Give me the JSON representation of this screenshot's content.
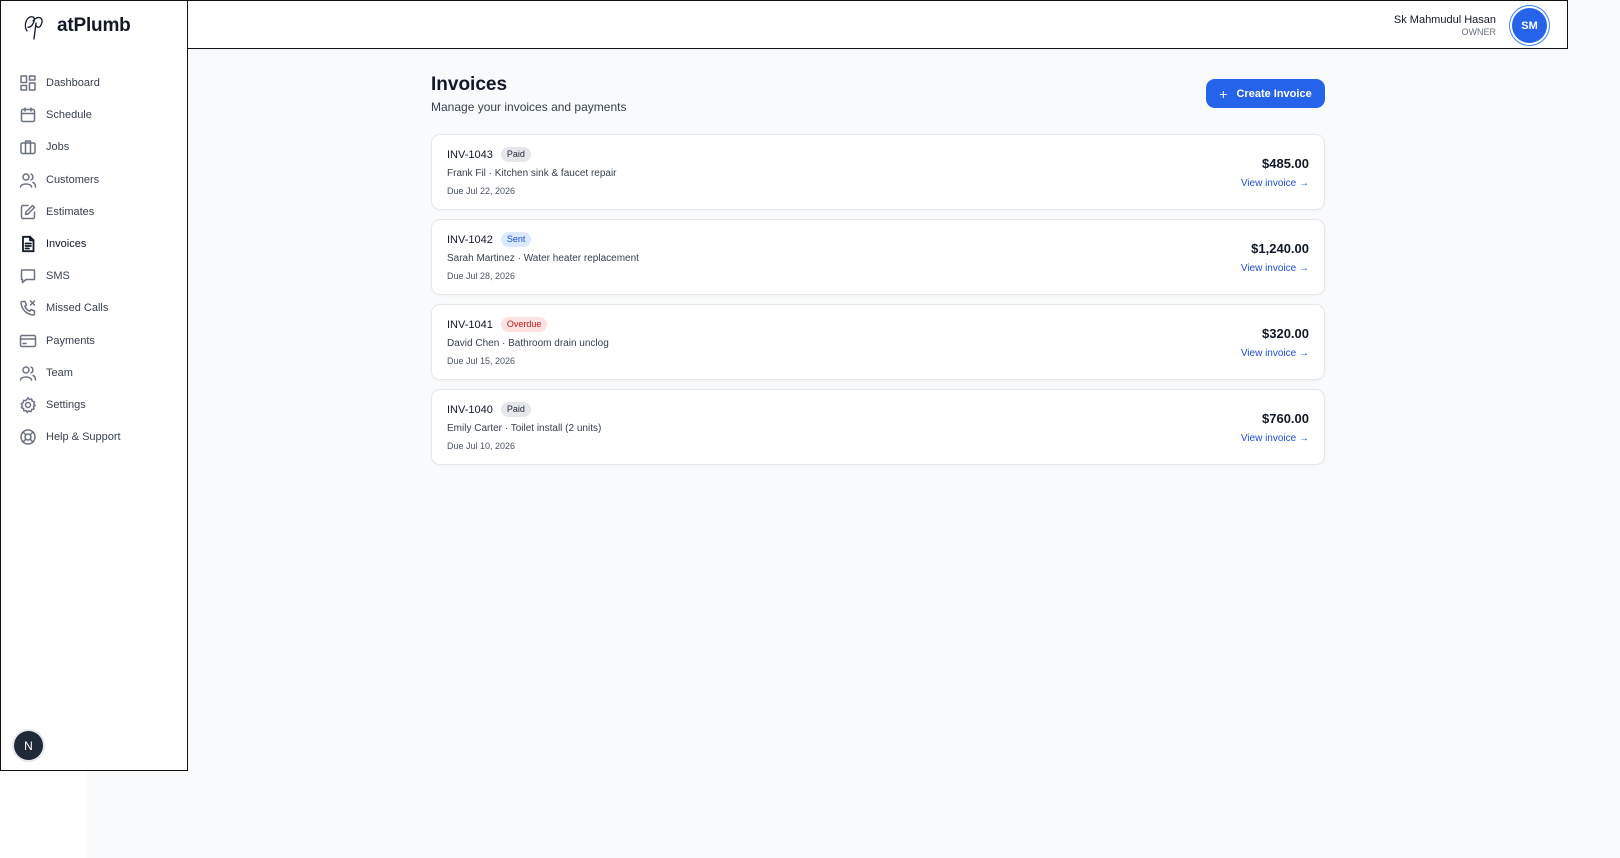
{
  "brand": {
    "name": "atPlumb"
  },
  "sidebar": {
    "items": [
      {
        "label": "Dashboard",
        "icon": "dashboard-icon",
        "active": false
      },
      {
        "label": "Schedule",
        "icon": "calendar-icon",
        "active": false
      },
      {
        "label": "Jobs",
        "icon": "briefcase-icon",
        "active": false
      },
      {
        "label": "Customers",
        "icon": "users-icon",
        "active": false
      },
      {
        "label": "Estimates",
        "icon": "edit-document-icon",
        "active": false
      },
      {
        "label": "Invoices",
        "icon": "document-icon",
        "active": true
      },
      {
        "label": "SMS",
        "icon": "chat-icon",
        "active": false
      },
      {
        "label": "Missed Calls",
        "icon": "missed-call-icon",
        "active": false
      },
      {
        "label": "Payments",
        "icon": "credit-card-icon",
        "active": false
      },
      {
        "label": "Team",
        "icon": "team-icon",
        "active": false
      },
      {
        "label": "Settings",
        "icon": "gear-icon",
        "active": false
      },
      {
        "label": "Help & Support",
        "icon": "lifebuoy-icon",
        "active": false
      }
    ],
    "bottom_badge": "N"
  },
  "header": {
    "user_name": "Sk Mahmudul Hasan",
    "user_role": "OWNER",
    "avatar_initials": "SM"
  },
  "main": {
    "title": "Invoices",
    "subtitle": "Manage your invoices and payments",
    "create_button_label": "Create Invoice",
    "invoices": [
      {
        "id": "INV-1043",
        "status": "Paid",
        "status_kind": "paid",
        "description": "Frank Fil · Kitchen sink & faucet repair",
        "due": "Due Jul 22, 2026",
        "amount": "$485.00",
        "link": "View invoice →"
      },
      {
        "id": "INV-1042",
        "status": "Sent",
        "status_kind": "sent",
        "description": "Sarah Martinez · Water heater replacement",
        "due": "Due Jul 28, 2026",
        "amount": "$1,240.00",
        "link": "View invoice →"
      },
      {
        "id": "INV-1041",
        "status": "Overdue",
        "status_kind": "overdue",
        "description": "David Chen · Bathroom drain unclog",
        "due": "Due Jul 15, 2026",
        "amount": "$320.00",
        "link": "View invoice →"
      },
      {
        "id": "INV-1040",
        "status": "Paid",
        "status_kind": "paid",
        "description": "Emily Carter · Toilet install (2 units)",
        "due": "Due Jul 10, 2026",
        "amount": "$760.00",
        "link": "View invoice →"
      }
    ]
  },
  "colors": {
    "accent": "#2563eb",
    "paid_bg": "#e5e7eb",
    "sent_bg": "#dbeafe",
    "overdue_bg": "#fee2e2"
  }
}
